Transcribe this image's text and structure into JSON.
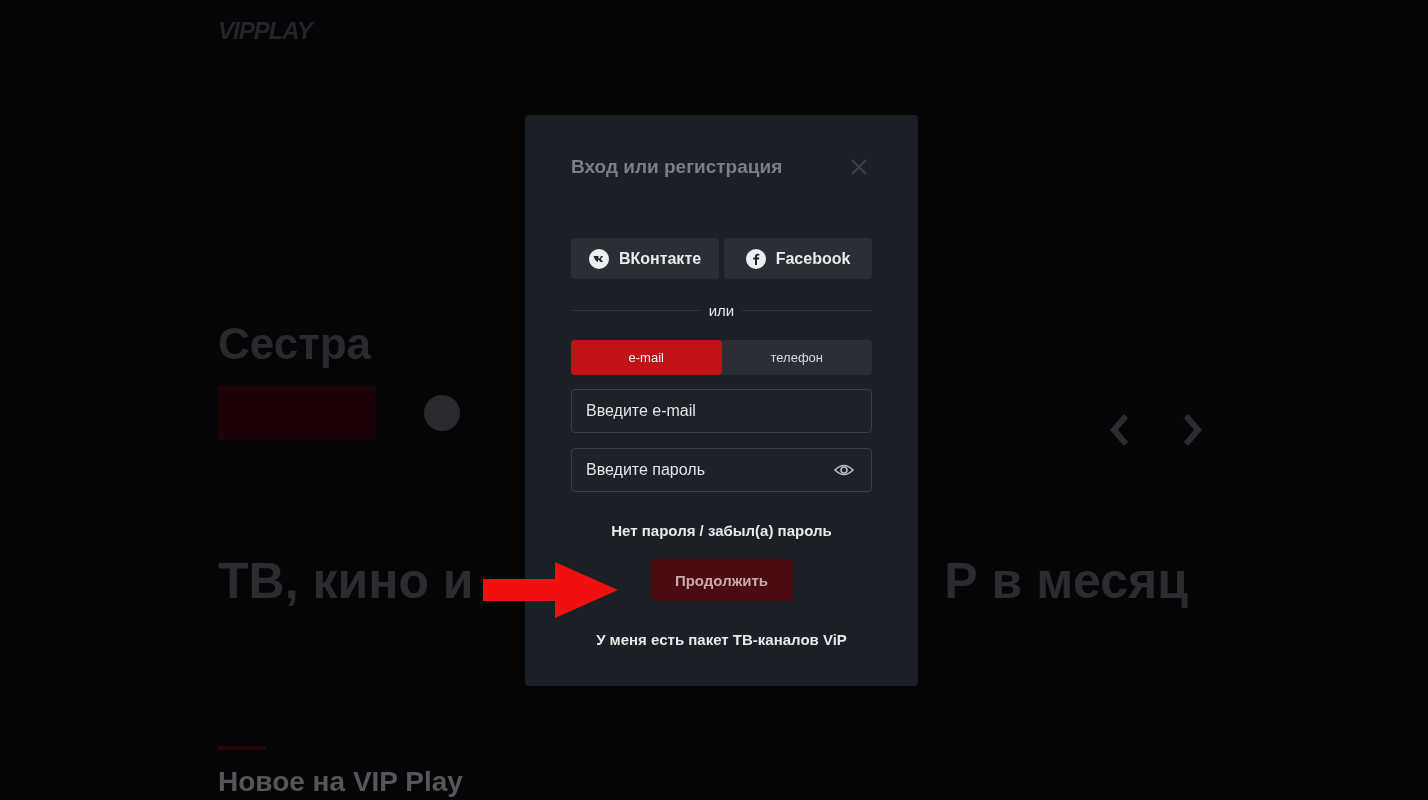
{
  "background": {
    "logo": "VIPPLAY",
    "hero_title": "Сестра",
    "headline_left": "ТВ, кино и",
    "headline_right": "Р в месяц",
    "section_title": "Новое на VIP Play"
  },
  "dialog": {
    "title": "Вход или регистрация",
    "social_buttons": [
      {
        "kind": "vk",
        "label": "ВКонтакте"
      },
      {
        "kind": "facebook",
        "label": "Facebook"
      }
    ],
    "divider": "или",
    "tabs": [
      {
        "label": "e-mail",
        "selected": true
      },
      {
        "label": "телефон",
        "selected": false
      }
    ],
    "fields": [
      {
        "kind": "text",
        "placeholder": "Введите e-mail"
      },
      {
        "kind": "password",
        "placeholder": "Введите пароль"
      }
    ],
    "forgot_link": "Нет пароля / забыл(а) пароль",
    "submit": "Продолжить",
    "vip_link": "У меня есть пакет ТВ-каналов ViP"
  }
}
